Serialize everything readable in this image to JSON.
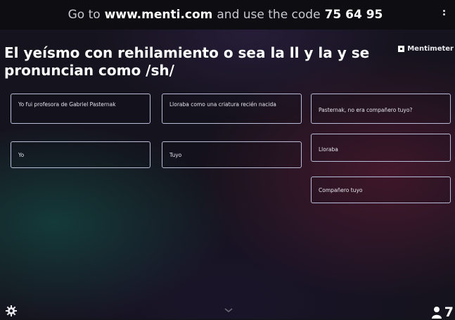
{
  "join_bar": {
    "prefix": "Go to",
    "url": "www.menti.com",
    "middle": "and use the code",
    "code": "75 64 95"
  },
  "slide": {
    "title": "El yeísmo con rehilamiento o sea la ll y la y se pronuncian como /sh/",
    "brand": "Mentimeter"
  },
  "responses": [
    "Yo fui profesora de Gabriel Pasternak",
    "Lloraba como una criatura recién nacida",
    "Pasternak, no era compañero tuyo?",
    "Yo",
    "Tuyo",
    "Lloraba",
    "Compañero tuyo"
  ],
  "footer": {
    "participants": "7",
    "icons": [
      "gear-icon",
      "chevron-down-icon",
      "person-icon"
    ]
  },
  "colors": {
    "card_border": "#b9bcd9",
    "topbar_bg": "#0d0d12"
  }
}
